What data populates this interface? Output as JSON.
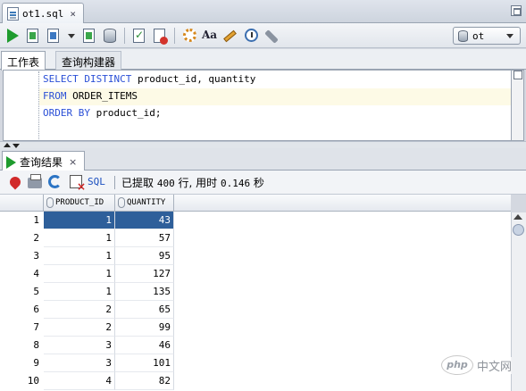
{
  "document_tab": {
    "label": "ot1.sql"
  },
  "connection": {
    "name": "ot"
  },
  "editor_tabs": [
    {
      "label": "工作表"
    },
    {
      "label": "查询构建器"
    }
  ],
  "editor": {
    "lines": [
      {
        "keyword1": "SELECT DISTINCT",
        "rest1": " product_id, quantity"
      },
      {
        "keyword1": "FROM",
        "rest1": " ORDER_ITEMS"
      },
      {
        "keyword1": "ORDER BY",
        "rest1": " product_id;"
      }
    ]
  },
  "results": {
    "tab_label": "查询结果",
    "sql_link": "SQL",
    "status_prefix": "已提取 ",
    "status_count": "400",
    "status_mid": " 行, 用时 ",
    "status_time": "0.146",
    "status_suffix": " 秒",
    "columns": [
      "PRODUCT_ID",
      "QUANTITY"
    ],
    "rows": [
      {
        "n": "1",
        "product_id": "1",
        "quantity": "43"
      },
      {
        "n": "2",
        "product_id": "1",
        "quantity": "57"
      },
      {
        "n": "3",
        "product_id": "1",
        "quantity": "95"
      },
      {
        "n": "4",
        "product_id": "1",
        "quantity": "127"
      },
      {
        "n": "5",
        "product_id": "1",
        "quantity": "135"
      },
      {
        "n": "6",
        "product_id": "2",
        "quantity": "65"
      },
      {
        "n": "7",
        "product_id": "2",
        "quantity": "99"
      },
      {
        "n": "8",
        "product_id": "3",
        "quantity": "46"
      },
      {
        "n": "9",
        "product_id": "3",
        "quantity": "101"
      },
      {
        "n": "10",
        "product_id": "4",
        "quantity": "82"
      }
    ]
  },
  "watermark": {
    "logo": "php",
    "text": "中文网"
  },
  "colors": {
    "selection": "#2e5f9a",
    "keyword": "#2a4fd6",
    "run_green": "#1e9b2e"
  }
}
